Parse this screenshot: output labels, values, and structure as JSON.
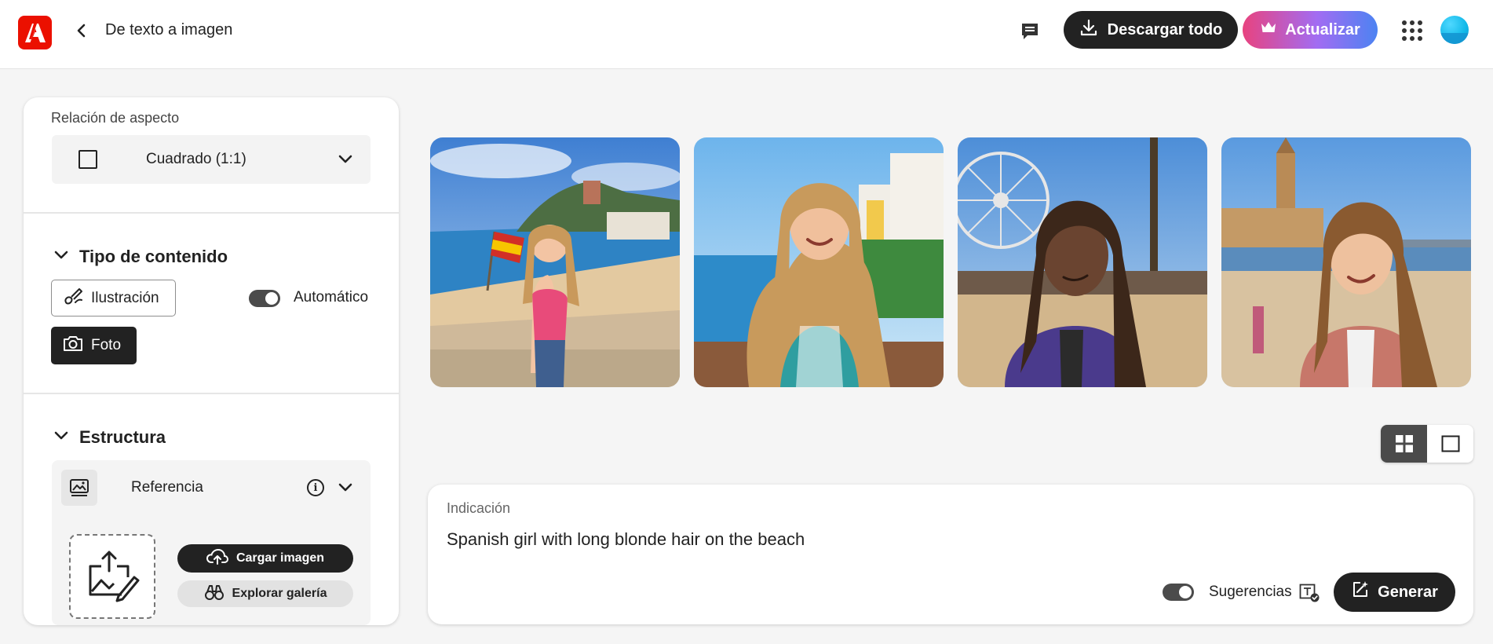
{
  "header": {
    "logo_icon": "adobe-logo",
    "back_icon": "chevron-left-icon",
    "title": "De texto a imagen",
    "feedback_icon": "message-icon",
    "download_label": "Descargar todo",
    "upgrade_label": "Actualizar",
    "apps_icon": "app-grid-icon",
    "avatar_icon": "user-avatar"
  },
  "colors": {
    "brand_red": "#eb1000",
    "dark": "#222222",
    "upgrade_gradient_start": "#e8437f",
    "upgrade_gradient_end": "#4c83f2"
  },
  "aspect": {
    "label": "Relación de aspecto",
    "value": "Cuadrado (1:1)"
  },
  "content_type": {
    "title": "Tipo de contenido",
    "illustration_label": "Ilustración",
    "photo_label": "Foto",
    "auto_label": "Automático",
    "auto_on": true,
    "selected": "Foto"
  },
  "structure": {
    "title": "Estructura",
    "reference_label": "Referencia",
    "upload_label": "Cargar imagen",
    "explore_label": "Explorar galería"
  },
  "images": [
    {
      "name": "generated-image-1"
    },
    {
      "name": "generated-image-2"
    },
    {
      "name": "generated-image-3"
    },
    {
      "name": "generated-image-4"
    }
  ],
  "view": {
    "grid_icon": "grid-view-icon",
    "single_icon": "single-view-icon",
    "selected": "grid"
  },
  "prompt": {
    "label": "Indicación",
    "text": "Spanish girl with long blonde hair on the beach",
    "suggestions_label": "Sugerencias",
    "suggestions_on": true,
    "generate_label": "Generar"
  }
}
